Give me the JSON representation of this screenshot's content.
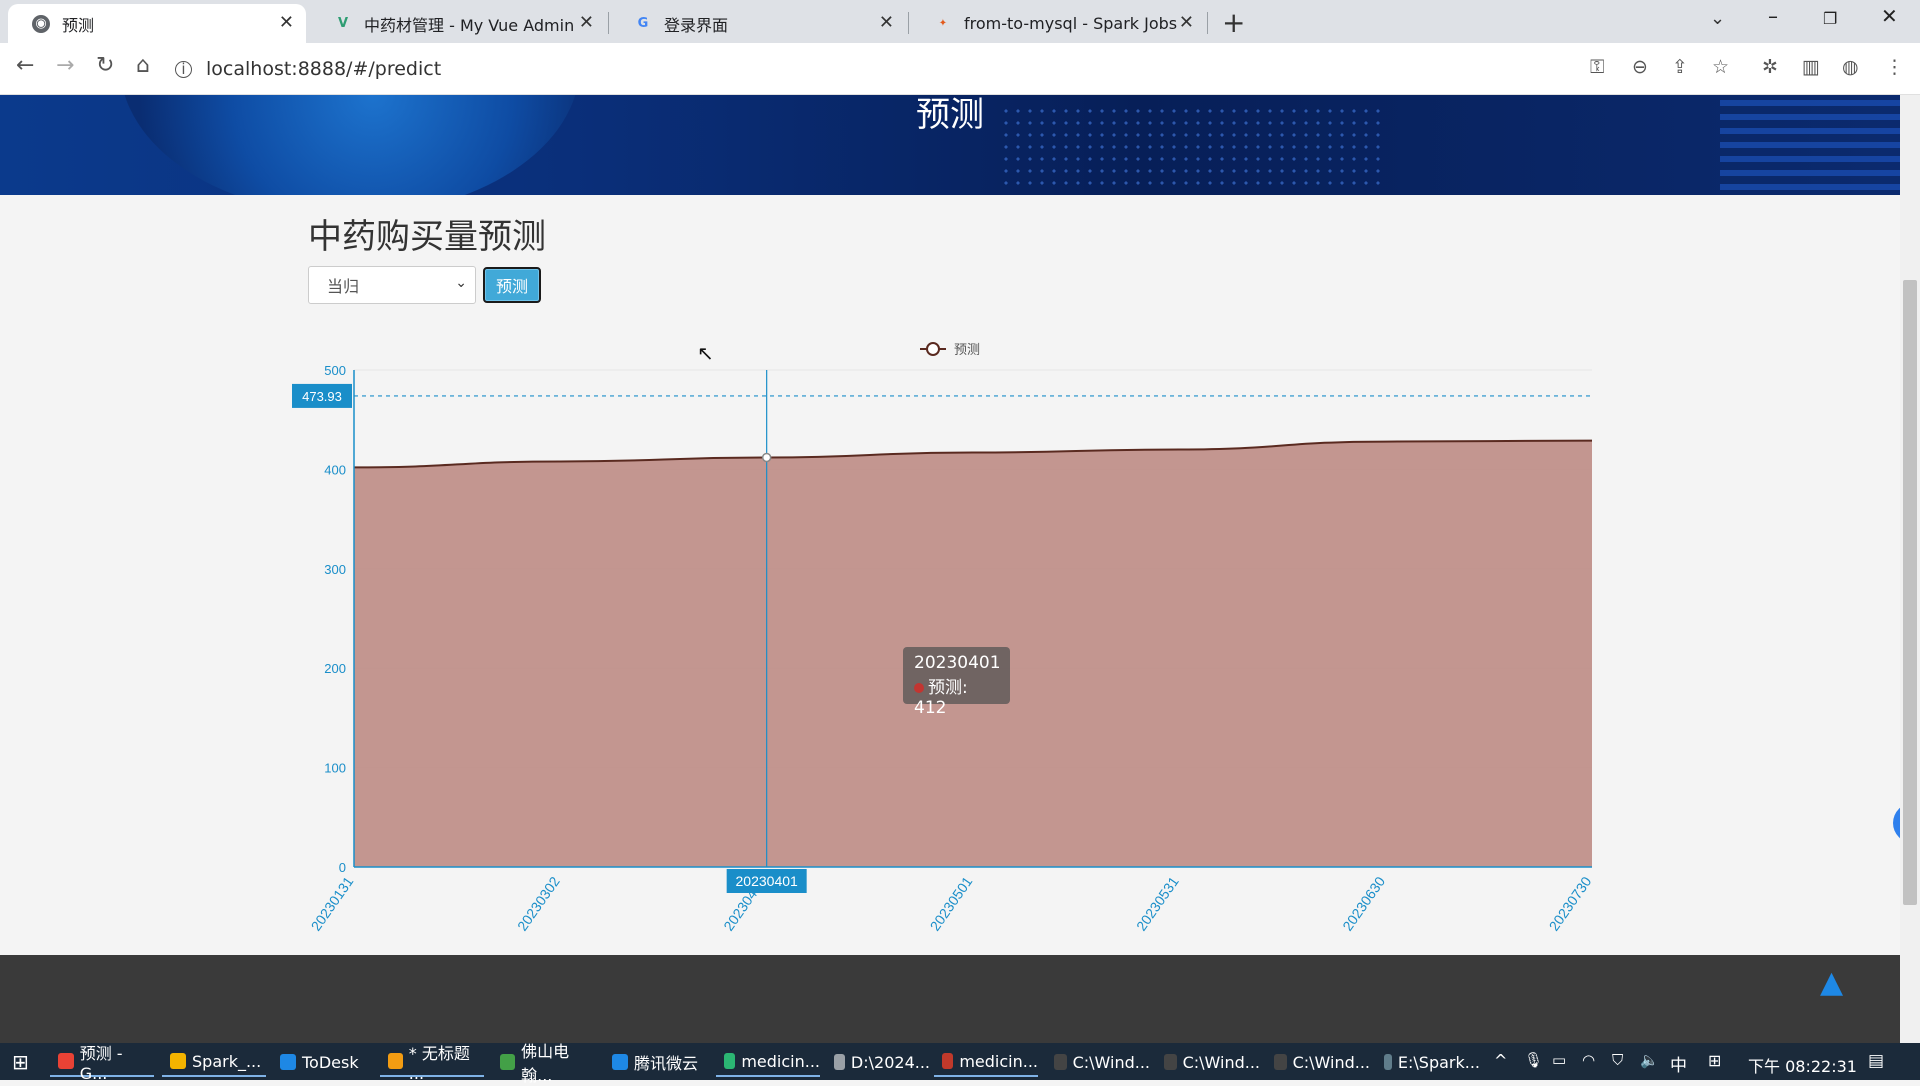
{
  "browser": {
    "tabs": [
      {
        "label": "预测",
        "active": true,
        "icon": "globe-icon"
      },
      {
        "label": "中药材管理 - My Vue Admin",
        "active": false,
        "icon": "vue-icon"
      },
      {
        "label": "登录界面",
        "active": false,
        "icon": "google-icon"
      },
      {
        "label": "from-to-mysql - Spark Jobs",
        "active": false,
        "icon": "spark-icon"
      }
    ],
    "url": "localhost:8888/#/predict"
  },
  "page": {
    "banner_title": "预测",
    "heading": "中药购买量预测",
    "select_value": "当归",
    "predict_button": "预测",
    "tooltip": {
      "date": "20230401",
      "text": "预测: 412"
    }
  },
  "chart_data": {
    "type": "area",
    "legend": [
      "预测"
    ],
    "x": [
      "20230131",
      "20230302",
      "20230401",
      "20230501",
      "20230531",
      "20230630",
      "20230730"
    ],
    "series": [
      {
        "name": "预测",
        "values": [
          402,
          408,
          412,
          417,
          420,
          428,
          429
        ]
      }
    ],
    "ylim": [
      0,
      500
    ],
    "yticks": [
      0,
      100,
      200,
      300,
      400,
      500
    ],
    "markline_value": "473.93",
    "pointer_x_label": "20230401",
    "colors": {
      "area": "#c0908a",
      "line": "#5a2a20",
      "axis": "#1a8ec9"
    }
  },
  "taskbar": {
    "items": [
      "预测 - G...",
      "Spark_...",
      "ToDesk",
      "* 无标题 ...",
      "佛山电翰...",
      "腾讯微云",
      "medicin...",
      "D:\\2024...",
      "medicin...",
      "C:\\Wind...",
      "C:\\Wind...",
      "C:\\Wind...",
      "E:\\Spark..."
    ],
    "ime": "中",
    "clock": "下午 08:22:31"
  }
}
